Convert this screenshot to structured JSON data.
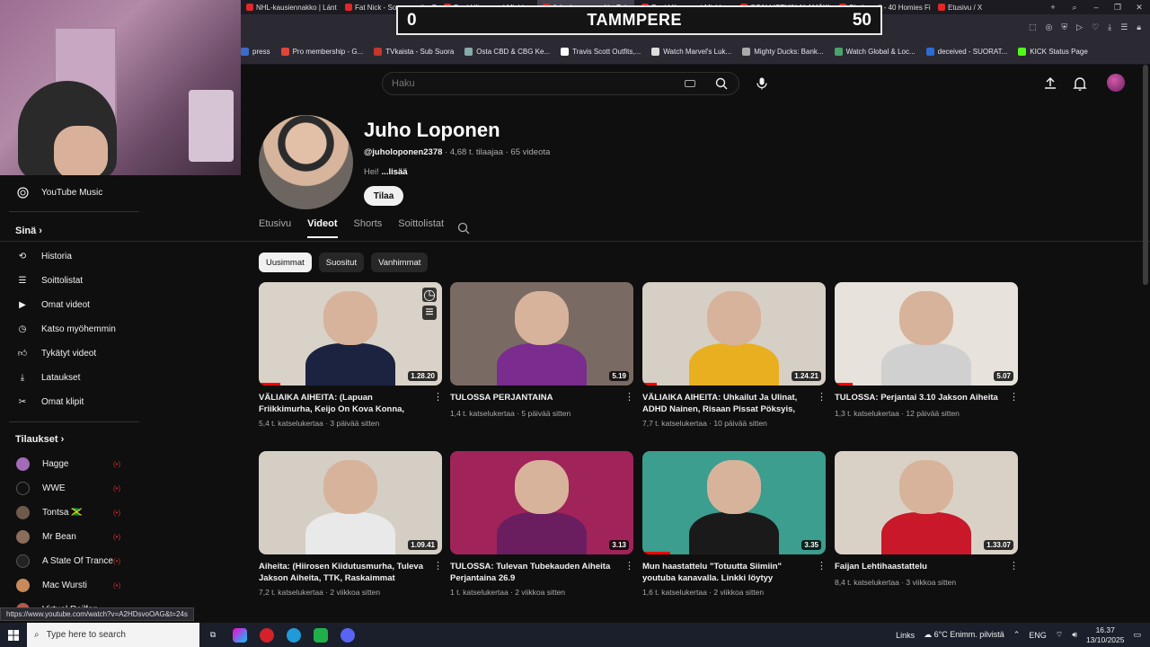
{
  "browser": {
    "tabs": [
      {
        "label": "NHL-kausiennakko | Lánt",
        "active": false
      },
      {
        "label": "Fat Nick - Songs on the Fri",
        "active": false
      },
      {
        "label": "Rani Hiirvonen | Mie'd...",
        "active": false
      },
      {
        "label": "Juho Loponen - YouTube",
        "active": true
      },
      {
        "label": "Rani Hiirvonen | Mic'd u...",
        "active": false
      },
      {
        "label": "OSALLISTUIN ALAMÄKI",
        "active": false
      },
      {
        "label": "Shakewell - 40 Homies Fi",
        "active": false
      },
      {
        "label": "Etusivu / X",
        "active": false
      }
    ],
    "bookmarks": [
      {
        "label": "press",
        "color": "#3b6cc9"
      },
      {
        "label": "Pro membership - G...",
        "color": "#e0453a"
      },
      {
        "label": "TVkaista - Sub Suora",
        "color": "#c3362b"
      },
      {
        "label": "Osta CBD & CBG Ke...",
        "color": "#8aa"
      },
      {
        "label": "Travis Scott Outfits,...",
        "color": "#fff"
      },
      {
        "label": "Watch Marvel's Luk...",
        "color": "#ddd"
      },
      {
        "label": "Mighty Ducks: Bank...",
        "color": "#aaa"
      },
      {
        "label": "Watch Global & Loc...",
        "color": "#4aa36b"
      },
      {
        "label": "deceived - SUORAT...",
        "color": "#2d6bd1"
      },
      {
        "label": "KICK Status Page",
        "color": "#53fc18"
      }
    ]
  },
  "scoreboard": {
    "left": "0",
    "city": "TAMMPERE",
    "right": "50"
  },
  "search": {
    "placeholder": "Haku"
  },
  "sidebar": {
    "items": [
      {
        "label": "YouTube Music",
        "icon": "youtube-music-icon"
      },
      {
        "label": "Historia",
        "icon": "history-icon"
      },
      {
        "label": "Soittolistat",
        "icon": "playlists-icon"
      },
      {
        "label": "Omat videot",
        "icon": "your-videos-icon"
      },
      {
        "label": "Katso myöhemmin",
        "icon": "watch-later-icon"
      },
      {
        "label": "Tykätyt videot",
        "icon": "liked-icon"
      },
      {
        "label": "Lataukset",
        "icon": "download-icon"
      },
      {
        "label": "Omat klipit",
        "icon": "clips-icon"
      }
    ],
    "you_heading": "Sinä",
    "subs_heading": "Tilaukset",
    "subscriptions": [
      {
        "label": "Hagge",
        "color": "#a26bb5"
      },
      {
        "label": "WWE",
        "color": "#111"
      },
      {
        "label": "Tontsa 🇯🇲",
        "color": "#6d5a4a"
      },
      {
        "label": "Mr Bean",
        "color": "#8a6d5b"
      },
      {
        "label": "A State Of Trance",
        "color": "#222"
      },
      {
        "label": "Mac Wursti",
        "color": "#c88a5a"
      },
      {
        "label": "Virtual Railfan",
        "color": "#b05a4a"
      }
    ]
  },
  "channel": {
    "name": "Juho Loponen",
    "handle": "@juholoponen2378",
    "stats": "· 4,68 t. tilaajaa · 65 videota",
    "desc_prefix": "Hei! ",
    "desc_more": "...lisää",
    "subscribe": "Tilaa",
    "tabs": [
      "Etusivu",
      "Videot",
      "Shorts",
      "Soittolistat"
    ],
    "chips": [
      "Uusimmat",
      "Suositut",
      "Vanhimmat"
    ]
  },
  "videos": [
    {
      "title": "VÄLIAIKA AIHEITA: (Lapuan Friikkimurha, Keijo On Kova Konna, Miesten Omistushalu)",
      "views": "5,4 t. katselukertaa · 3 päivää sitten",
      "duration": "1.28.20",
      "bg": "#d9d2c8",
      "shirt": "#1b2340",
      "progress": 0.12
    },
    {
      "title": "TULOSSA PERJANTAINA",
      "views": "1,4 t. katselukertaa · 5 päivää sitten",
      "duration": "5.19",
      "bg": "#7a6a64",
      "shirt": "#7a2c8f",
      "progress": 0
    },
    {
      "title": "VÄLIAIKA AIHEITA: Uhkailut Ja Ulinat, ADHD Nainen, Risaan Pissat Pöksyis, Mimmit Ja...",
      "views": "7,7 t. katselukertaa · 10 päivää sitten",
      "duration": "1.24.21",
      "bg": "#d6cfc5",
      "shirt": "#e8b021",
      "progress": 0.08
    },
    {
      "title": "TULOSSA: Perjantai 3.10 Jakson Aiheita",
      "views": "1,3 t. katselukertaa · 12 päivää sitten",
      "duration": "5.07",
      "bg": "#e7e2db",
      "shirt": "#d0d0d0",
      "progress": 0.1
    },
    {
      "title": "Aiheita: (Hiirosen Kiidutusmurha, Tuleva Jakson Aiheita, TTK, Raskaimmat Aiheet...",
      "views": "7,2 t. katselukertaa · 2 viikkoa sitten",
      "duration": "1.09.41",
      "bg": "#d5cec4",
      "shirt": "#e9e9e9",
      "progress": 0
    },
    {
      "title": "TULOSSA: Tulevan Tubekauden Aiheita Perjantaina 26.9",
      "views": "1 t. katselukertaa · 2 viikkoa sitten",
      "duration": "3.13",
      "bg": "#a0245a",
      "shirt": "#6a1e60",
      "progress": 0
    },
    {
      "title": "Mun haastattelu \"Totuutta Siimiin\" youtuba kanavalla. Linkki löytyy kuvauksesta.",
      "views": "1,6 t. katselukertaa · 2 viikkoa sitten",
      "duration": "3.35",
      "bg": "#3b9e8e",
      "shirt": "#1a1a1a",
      "progress": 0.15
    },
    {
      "title": "Faijan Lehtihaastattelu",
      "views": "8,4 t. katselukertaa · 3 viikkoa sitten",
      "duration": "1.33.07",
      "bg": "#d9d1c6",
      "shirt": "#c8182a",
      "progress": 0
    }
  ],
  "status_url": "https://www.youtube.com/watch?v=A2HDsvoOAG&t=24s",
  "taskbar": {
    "search_placeholder": "Type here to search",
    "links": "Links",
    "weather": "6°C  Enimm. pilvistä",
    "lang": "ENG",
    "time": "16.37",
    "date": "13/10/2025"
  }
}
